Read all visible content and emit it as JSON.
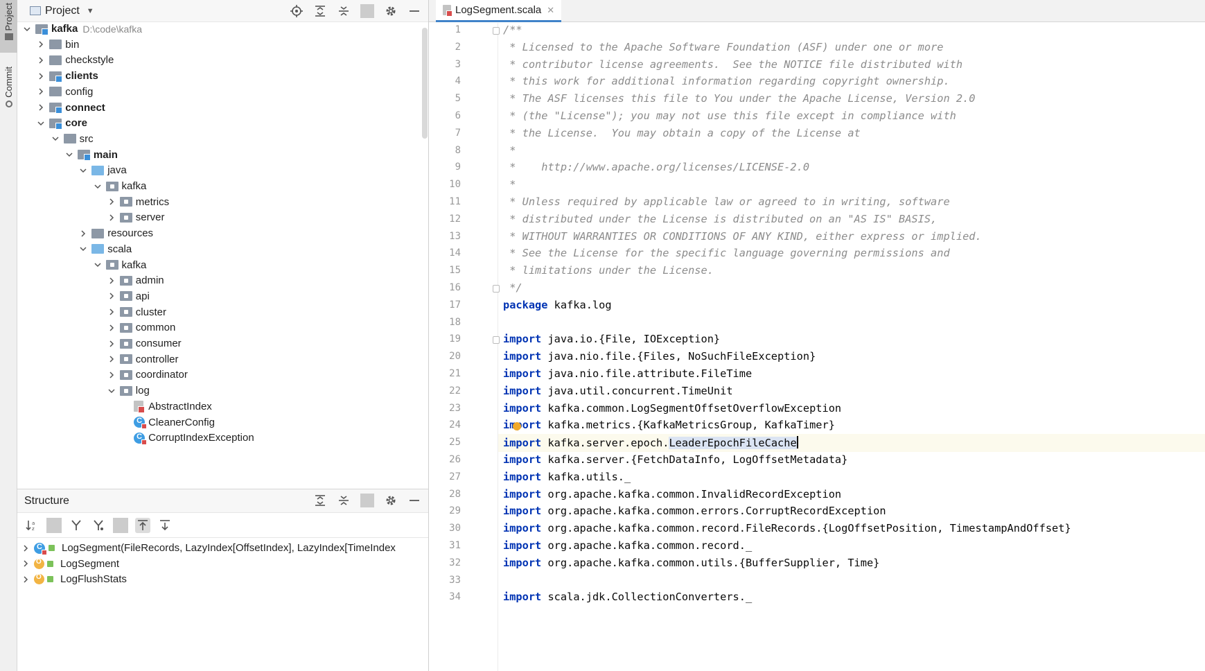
{
  "left_strip": {
    "project_tab": "Project",
    "commit_tab": "Commit"
  },
  "project_panel": {
    "title": "Project",
    "tree": [
      {
        "label": "kafka",
        "path": "D:\\code\\kafka",
        "depth": 0,
        "expanded": true,
        "bold": true,
        "icon": "module-folder"
      },
      {
        "label": "bin",
        "depth": 1,
        "expanded": false,
        "bold": false,
        "icon": "folder"
      },
      {
        "label": "checkstyle",
        "depth": 1,
        "expanded": false,
        "bold": false,
        "icon": "folder"
      },
      {
        "label": "clients",
        "depth": 1,
        "expanded": false,
        "bold": true,
        "icon": "module-folder"
      },
      {
        "label": "config",
        "depth": 1,
        "expanded": false,
        "bold": false,
        "icon": "folder"
      },
      {
        "label": "connect",
        "depth": 1,
        "expanded": false,
        "bold": true,
        "icon": "module-folder"
      },
      {
        "label": "core",
        "depth": 1,
        "expanded": true,
        "bold": true,
        "icon": "module-folder"
      },
      {
        "label": "src",
        "depth": 2,
        "expanded": true,
        "bold": false,
        "icon": "folder"
      },
      {
        "label": "main",
        "depth": 3,
        "expanded": true,
        "bold": true,
        "icon": "module-folder"
      },
      {
        "label": "java",
        "depth": 4,
        "expanded": true,
        "bold": false,
        "icon": "source-folder"
      },
      {
        "label": "kafka",
        "depth": 5,
        "expanded": true,
        "bold": false,
        "icon": "package-folder"
      },
      {
        "label": "metrics",
        "depth": 6,
        "expanded": false,
        "bold": false,
        "icon": "package-folder"
      },
      {
        "label": "server",
        "depth": 6,
        "expanded": false,
        "bold": false,
        "icon": "package-folder"
      },
      {
        "label": "resources",
        "depth": 4,
        "expanded": false,
        "bold": false,
        "icon": "resources-folder"
      },
      {
        "label": "scala",
        "depth": 4,
        "expanded": true,
        "bold": false,
        "icon": "source-folder"
      },
      {
        "label": "kafka",
        "depth": 5,
        "expanded": true,
        "bold": false,
        "icon": "package-folder"
      },
      {
        "label": "admin",
        "depth": 6,
        "expanded": false,
        "bold": false,
        "icon": "package-folder"
      },
      {
        "label": "api",
        "depth": 6,
        "expanded": false,
        "bold": false,
        "icon": "package-folder"
      },
      {
        "label": "cluster",
        "depth": 6,
        "expanded": false,
        "bold": false,
        "icon": "package-folder"
      },
      {
        "label": "common",
        "depth": 6,
        "expanded": false,
        "bold": false,
        "icon": "package-folder"
      },
      {
        "label": "consumer",
        "depth": 6,
        "expanded": false,
        "bold": false,
        "icon": "package-folder"
      },
      {
        "label": "controller",
        "depth": 6,
        "expanded": false,
        "bold": false,
        "icon": "package-folder"
      },
      {
        "label": "coordinator",
        "depth": 6,
        "expanded": false,
        "bold": false,
        "icon": "package-folder"
      },
      {
        "label": "log",
        "depth": 6,
        "expanded": true,
        "bold": false,
        "icon": "package-folder"
      },
      {
        "label": "AbstractIndex",
        "depth": 7,
        "leaf": true,
        "bold": false,
        "icon": "scala-file"
      },
      {
        "label": "CleanerConfig",
        "depth": 7,
        "leaf": true,
        "bold": false,
        "icon": "class"
      },
      {
        "label": "CorruptIndexException",
        "depth": 7,
        "leaf": true,
        "bold": false,
        "icon": "class"
      }
    ]
  },
  "structure_panel": {
    "title": "Structure",
    "items": [
      {
        "label": "LogSegment(FileRecords, LazyIndex[OffsetIndex], LazyIndex[TimeIndex",
        "icon": "class"
      },
      {
        "label": "LogSegment",
        "icon": "object"
      },
      {
        "label": "LogFlushStats",
        "icon": "object"
      }
    ]
  },
  "editor": {
    "tab_label": "LogSegment.scala",
    "current_line": 25,
    "lines": [
      {
        "n": "1",
        "type": "comment",
        "text": "/**"
      },
      {
        "n": "2",
        "type": "comment",
        "text": " * Licensed to the Apache Software Foundation (ASF) under one or more"
      },
      {
        "n": "3",
        "type": "comment",
        "text": " * contributor license agreements.  See the NOTICE file distributed with"
      },
      {
        "n": "4",
        "type": "comment",
        "text": " * this work for additional information regarding copyright ownership."
      },
      {
        "n": "5",
        "type": "comment",
        "text": " * The ASF licenses this file to You under the Apache License, Version 2.0"
      },
      {
        "n": "6",
        "type": "comment",
        "text": " * (the \"License\"); you may not use this file except in compliance with"
      },
      {
        "n": "7",
        "type": "comment",
        "text": " * the License.  You may obtain a copy of the License at"
      },
      {
        "n": "8",
        "type": "comment",
        "text": " *"
      },
      {
        "n": "9",
        "type": "comment",
        "text": " *    http://www.apache.org/licenses/LICENSE-2.0"
      },
      {
        "n": "10",
        "type": "comment",
        "text": " *"
      },
      {
        "n": "11",
        "type": "comment",
        "text": " * Unless required by applicable law or agreed to in writing, software"
      },
      {
        "n": "12",
        "type": "comment",
        "text": " * distributed under the License is distributed on an \"AS IS\" BASIS,"
      },
      {
        "n": "13",
        "type": "comment",
        "text": " * WITHOUT WARRANTIES OR CONDITIONS OF ANY KIND, either express or implied."
      },
      {
        "n": "14",
        "type": "comment",
        "text": " * See the License for the specific language governing permissions and"
      },
      {
        "n": "15",
        "type": "comment",
        "text": " * limitations under the License."
      },
      {
        "n": "16",
        "type": "comment",
        "text": " */"
      },
      {
        "n": "17",
        "type": "code",
        "kw": "package",
        "text": " kafka.log"
      },
      {
        "n": "18",
        "type": "blank",
        "text": ""
      },
      {
        "n": "19",
        "type": "code",
        "kw": "import",
        "text": " java.io.{File, IOException}"
      },
      {
        "n": "20",
        "type": "code",
        "kw": "import",
        "text": " java.nio.file.{Files, NoSuchFileException}"
      },
      {
        "n": "21",
        "type": "code",
        "kw": "import",
        "text": " java.nio.file.attribute.FileTime"
      },
      {
        "n": "22",
        "type": "code",
        "kw": "import",
        "text": " java.util.concurrent.TimeUnit"
      },
      {
        "n": "23",
        "type": "code",
        "kw": "import",
        "text": " kafka.common.LogSegmentOffsetOverflowException"
      },
      {
        "n": "24",
        "type": "code",
        "kw": "import",
        "text": " kafka.metrics.{KafkaMetricsGroup, KafkaTimer}"
      },
      {
        "n": "25",
        "type": "code",
        "kw": "import",
        "text": " kafka.server.epoch.",
        "highlight": "LeaderEpochFileCache"
      },
      {
        "n": "26",
        "type": "code",
        "kw": "import",
        "text": " kafka.server.{FetchDataInfo, LogOffsetMetadata}"
      },
      {
        "n": "27",
        "type": "code",
        "kw": "import",
        "text": " kafka.utils._"
      },
      {
        "n": "28",
        "type": "code",
        "kw": "import",
        "text": " org.apache.kafka.common.InvalidRecordException"
      },
      {
        "n": "29",
        "type": "code",
        "kw": "import",
        "text": " org.apache.kafka.common.errors.CorruptRecordException"
      },
      {
        "n": "30",
        "type": "code",
        "kw": "import",
        "text": " org.apache.kafka.common.record.FileRecords.{LogOffsetPosition, TimestampAndOffset}"
      },
      {
        "n": "31",
        "type": "code",
        "kw": "import",
        "text": " org.apache.kafka.common.record._"
      },
      {
        "n": "32",
        "type": "code",
        "kw": "import",
        "text": " org.apache.kafka.common.utils.{BufferSupplier, Time}"
      },
      {
        "n": "33",
        "type": "blank",
        "text": ""
      },
      {
        "n": "34",
        "type": "code",
        "kw": "import",
        "text": " scala.jdk.CollectionConverters._"
      }
    ]
  },
  "colors": {
    "keyword": "#0033b3",
    "comment": "#8c8c8c",
    "selection": "#dbe4f3",
    "tab_accent": "#4083c9"
  }
}
